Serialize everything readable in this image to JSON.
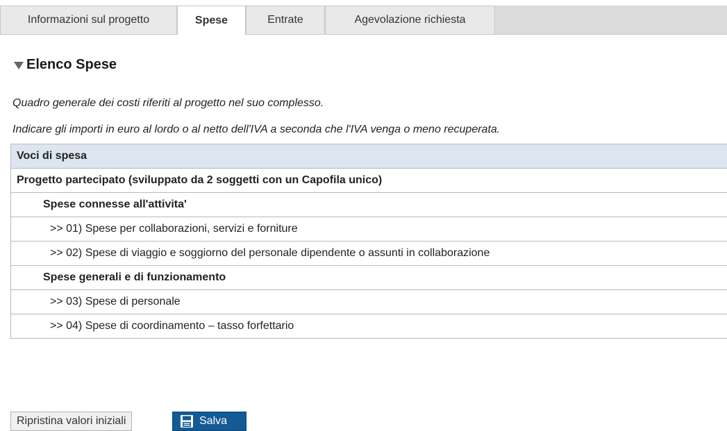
{
  "tabs": [
    {
      "label": "Informazioni sul progetto",
      "active": false
    },
    {
      "label": "Spese",
      "active": true
    },
    {
      "label": "Entrate",
      "active": false
    },
    {
      "label": "Agevolazione richiesta",
      "active": false
    }
  ],
  "section": {
    "title": "Elenco Spese",
    "desc1": "Quadro generale dei costi riferiti al progetto nel suo complesso.",
    "desc2": "Indicare gli importi in euro al lordo o al netto dell'IVA a seconda che l'IVA venga o meno recuperata."
  },
  "table": {
    "header": "Voci di spesa",
    "rows": [
      {
        "type": "group",
        "label": "Progetto partecipato (sviluppato da 2 soggetti con un Capofila unico)"
      },
      {
        "type": "subgroup",
        "label": "Spese connesse all'attivita'"
      },
      {
        "type": "item",
        "label": ">> 01) Spese per collaborazioni, servizi e forniture"
      },
      {
        "type": "item",
        "label": ">> 02) Spese di viaggio e soggiorno del personale dipendente o assunti in collaborazione"
      },
      {
        "type": "subgroup",
        "label": "Spese generali e di funzionamento"
      },
      {
        "type": "item",
        "label": ">> 03) Spese di personale"
      },
      {
        "type": "item",
        "label": ">> 04) Spese di coordinamento – tasso forfettario"
      }
    ]
  },
  "buttons": {
    "reset_label": "Ripristina valori iniziali",
    "save_label": "Salva",
    "save_icon": "floppy-disk-icon"
  },
  "colors": {
    "header_bg": "#dde6f0",
    "save_bg": "#145a94",
    "tabbar_bg": "#dcdcdc"
  }
}
